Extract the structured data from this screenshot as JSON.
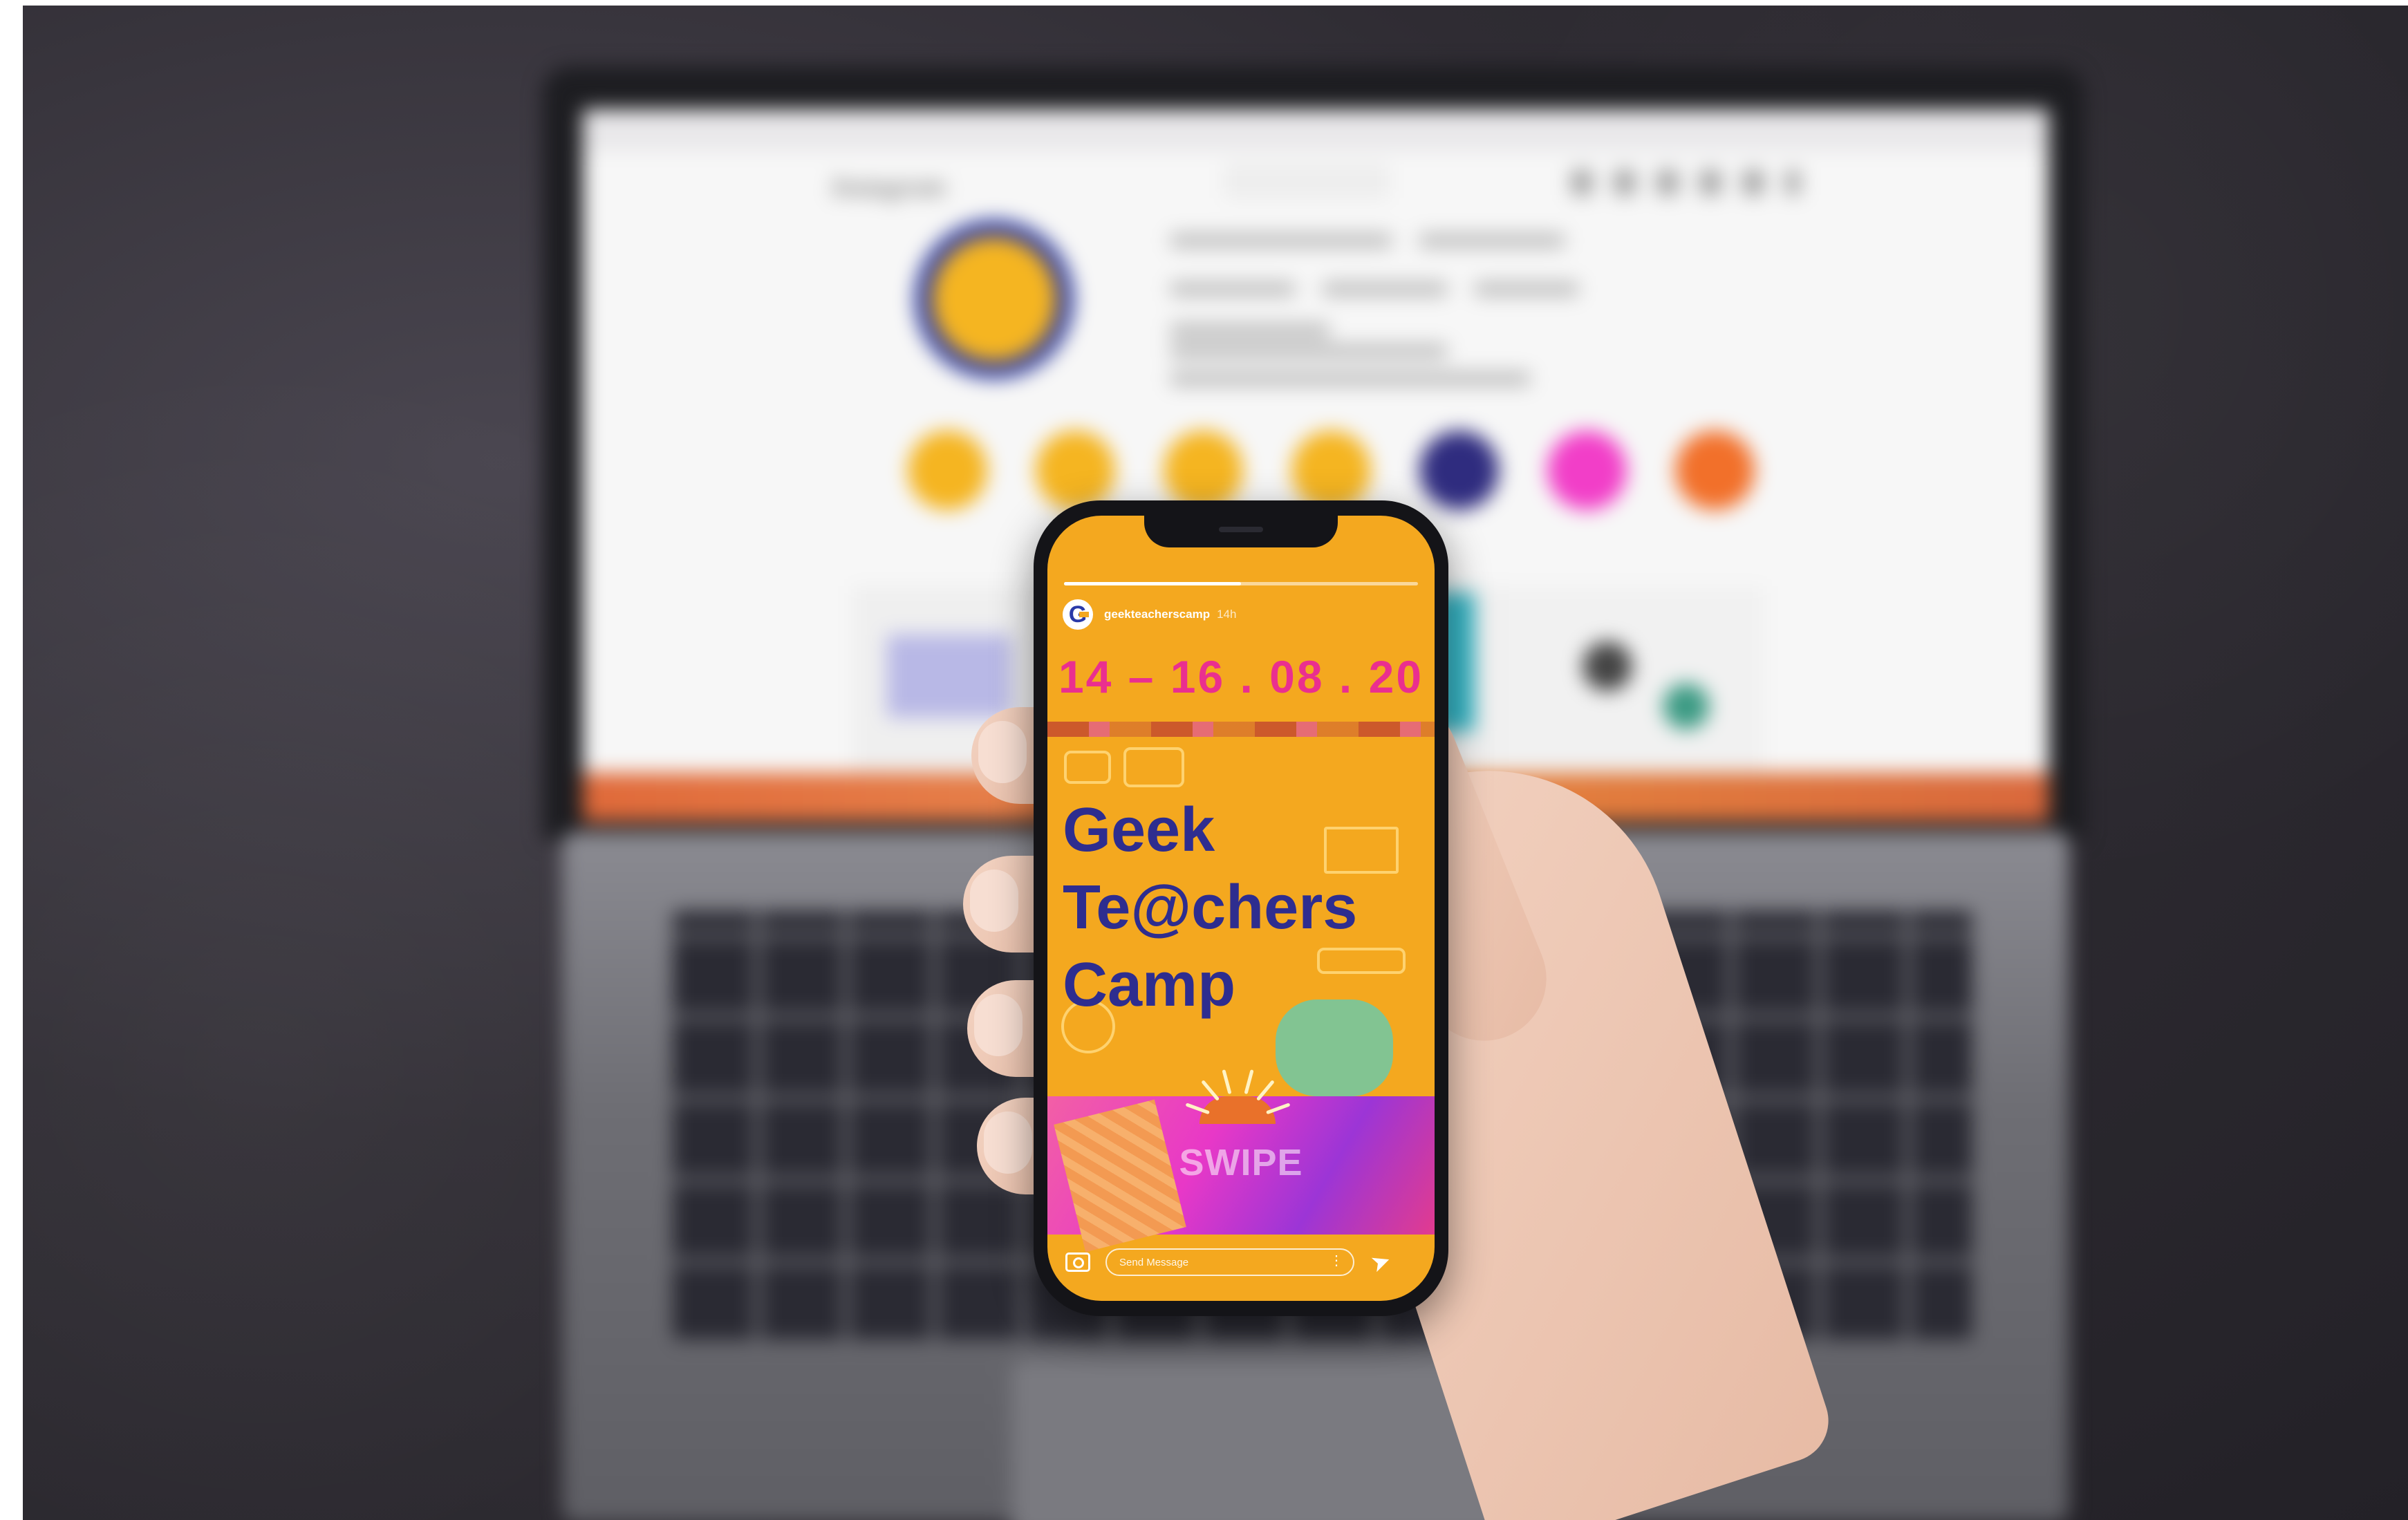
{
  "story": {
    "username": "geekteacherscamp",
    "time": "14h",
    "avatar_letter": "G",
    "dates": "14 – 16 . 08 . 20",
    "title_lines": [
      "Geek",
      "Te@chers",
      "Camp"
    ],
    "swipe_label": "SWIPE",
    "message_placeholder": "Send Message",
    "progress_fraction": 0.5
  },
  "laptop": {
    "app_name": "Instagram"
  },
  "colors": {
    "story_background": "#f4a81f",
    "date_pink": "#ea2f8f",
    "title_navy": "#2e2d8f",
    "highlight_colors": [
      "#f5b521",
      "#f5b521",
      "#f5b521",
      "#f5b521",
      "#2f2c7f",
      "#f23ec8",
      "#f2702a"
    ]
  },
  "icons": {
    "camera": "camera-icon",
    "more": "more-options-icon",
    "send": "send-icon"
  }
}
